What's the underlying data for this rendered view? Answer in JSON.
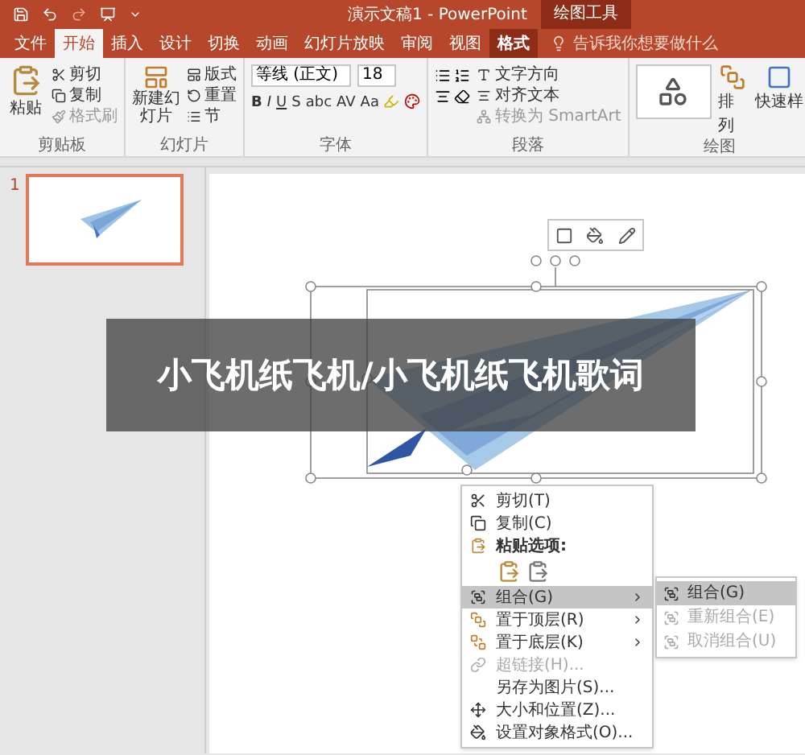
{
  "window": {
    "title": "演示文稿1 - PowerPoint"
  },
  "contextual_group": "绘图工具",
  "tabs": [
    {
      "label": "文件",
      "selected": false,
      "contextual": false
    },
    {
      "label": "开始",
      "selected": true,
      "contextual": false
    },
    {
      "label": "插入",
      "selected": false,
      "contextual": false
    },
    {
      "label": "设计",
      "selected": false,
      "contextual": false
    },
    {
      "label": "切换",
      "selected": false,
      "contextual": false
    },
    {
      "label": "动画",
      "selected": false,
      "contextual": false
    },
    {
      "label": "幻灯片放映",
      "selected": false,
      "contextual": false
    },
    {
      "label": "审阅",
      "selected": false,
      "contextual": false
    },
    {
      "label": "视图",
      "selected": false,
      "contextual": false
    },
    {
      "label": "格式",
      "selected": false,
      "contextual": true
    }
  ],
  "tell_me": {
    "placeholder": "告诉我你想要做什么"
  },
  "clipboard": {
    "label": "剪贴板",
    "paste": "粘贴",
    "cut": "剪切",
    "copy": "复制",
    "format_painter": "格式刷"
  },
  "slides_group": {
    "label": "幻灯片",
    "new_slide": "新建幻灯片",
    "layout": "版式",
    "reset": "重置",
    "section": "节"
  },
  "font": {
    "label": "字体",
    "font_name": "等线 (正文)",
    "font_size": "18",
    "buttons": [
      "B",
      "I",
      "U",
      "S",
      "abc",
      "AV",
      "Aa"
    ]
  },
  "paragraph": {
    "label": "段落",
    "text_direction": "文字方向",
    "align_text": "对齐文本",
    "convert_smartart": "转换为 SmartArt"
  },
  "drawing": {
    "label": "绘图",
    "arrange": "排列",
    "quick_styles": "快速样"
  },
  "thumbnails": [
    {
      "number": "1",
      "selected": true
    }
  ],
  "context_menu": {
    "items": [
      {
        "kind": "item",
        "label": "剪切(T)",
        "disabled": false,
        "selected": false,
        "submenu": false
      },
      {
        "kind": "item",
        "label": "复制(C)",
        "disabled": false,
        "selected": false,
        "submenu": false
      },
      {
        "kind": "header",
        "label": "粘贴选项:",
        "disabled": false,
        "selected": false,
        "submenu": false
      },
      {
        "kind": "paste_icons",
        "disabled": false,
        "selected": false,
        "submenu": false
      },
      {
        "kind": "item",
        "label": "组合(G)",
        "disabled": false,
        "selected": true,
        "submenu": true
      },
      {
        "kind": "item",
        "label": "置于顶层(R)",
        "disabled": false,
        "selected": false,
        "submenu": true
      },
      {
        "kind": "item",
        "label": "置于底层(K)",
        "disabled": false,
        "selected": false,
        "submenu": true
      },
      {
        "kind": "item",
        "label": "超链接(H)...",
        "disabled": true,
        "selected": false,
        "submenu": false
      },
      {
        "kind": "item",
        "label": "另存为图片(S)...",
        "disabled": false,
        "selected": false,
        "submenu": false
      },
      {
        "kind": "item",
        "label": "大小和位置(Z)...",
        "disabled": false,
        "selected": false,
        "submenu": false
      },
      {
        "kind": "item",
        "label": "设置对象格式(O)...",
        "disabled": false,
        "selected": false,
        "submenu": false
      }
    ]
  },
  "submenu": {
    "items": [
      {
        "label": "组合(G)",
        "disabled": false,
        "selected": true
      },
      {
        "label": "重新组合(E)",
        "disabled": true,
        "selected": false
      },
      {
        "label": "取消组合(U)",
        "disabled": true,
        "selected": false
      }
    ]
  },
  "caption": "小飞机纸飞机/小飞机纸飞机歌词"
}
